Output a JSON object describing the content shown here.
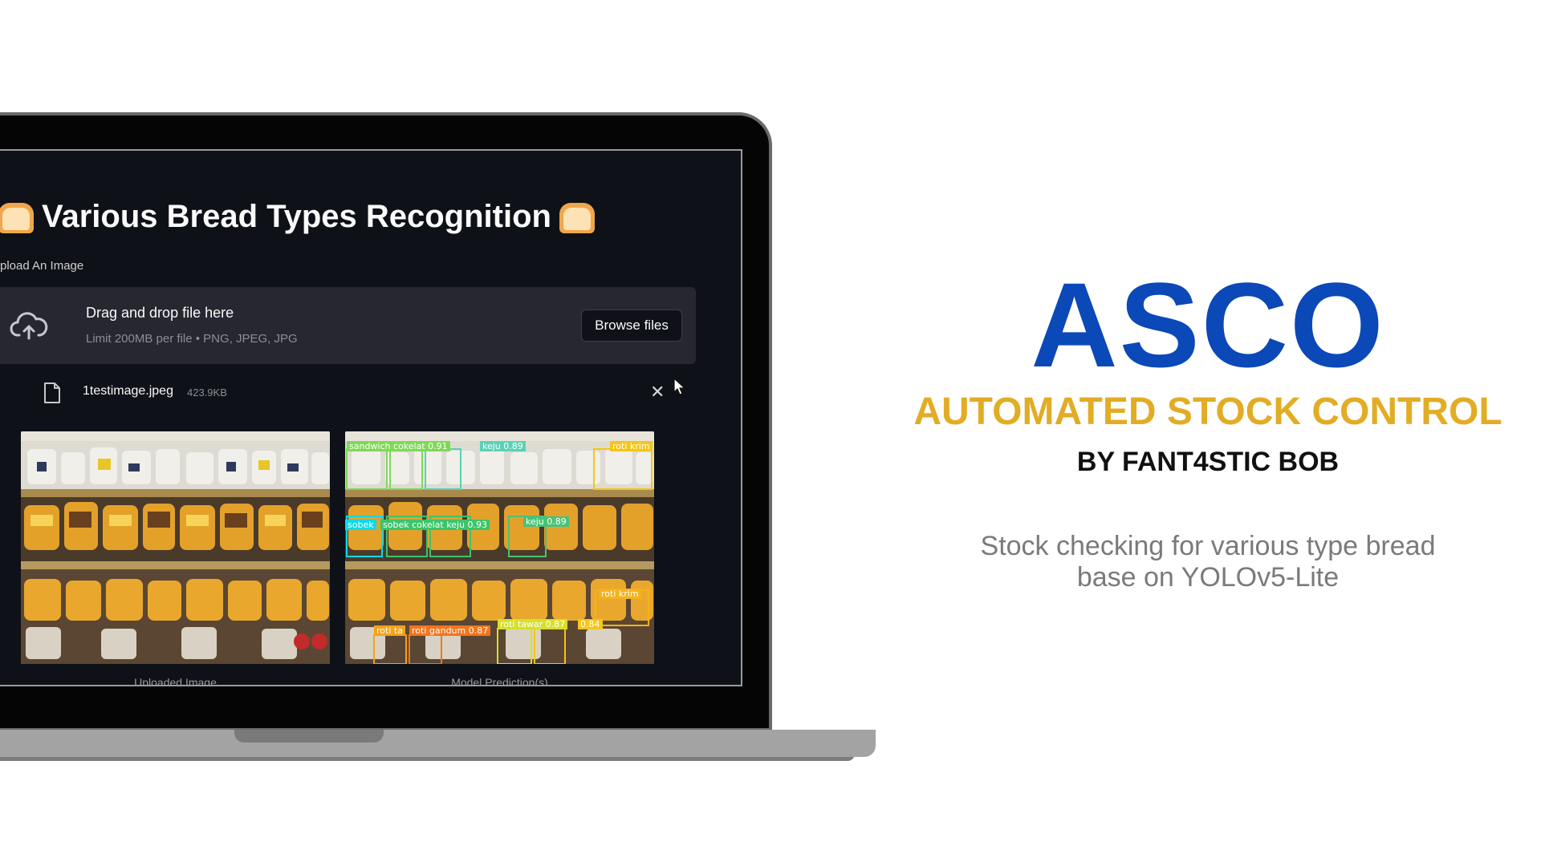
{
  "app": {
    "title": "Various Bread Types Recognition",
    "upload_label": "pload An Image",
    "dropzone": {
      "title": "Drag and drop file here",
      "subtitle": "Limit 200MB per file • PNG, JPEG, JPG",
      "browse_label": "Browse files"
    },
    "file": {
      "name": "1testimage.jpeg",
      "size": "423.9KB"
    },
    "captions": {
      "uploaded": "Uploaded Image",
      "prediction": "Model Prediction(s)"
    },
    "detections": [
      {
        "label": "sandwich cokelat 0.91",
        "color": "#7ed957"
      },
      {
        "label": "keju 0.89",
        "color": "#5ad1b6"
      },
      {
        "label": "roti krim",
        "color": "#f5c518"
      },
      {
        "label": "sobek",
        "color": "#12d8e6"
      },
      {
        "label": "sobek cokelat keju 0.93",
        "color": "#3cc46a"
      },
      {
        "label": "keju 0.89",
        "color": "#49c276"
      },
      {
        "label": "roti krim",
        "color": "#f5b21a"
      },
      {
        "label": "roti ta",
        "color": "#f4a21c"
      },
      {
        "label": "roti gandum 0.87",
        "color": "#f0751e"
      },
      {
        "label": "roti tawar 0.87",
        "color": "#d6e02a"
      },
      {
        "label": "0.84",
        "color": "#f5c518"
      }
    ]
  },
  "brand": {
    "name": "ASCO",
    "tagline": "AUTOMATED STOCK CONTROL",
    "byline": "BY FANT4STIC BOB",
    "description_line1": "Stock checking for various type bread",
    "description_line2": "base on YOLOv5-Lite",
    "colors": {
      "name": "#0b48b8",
      "tagline": "#e2ac25",
      "byline": "#111111",
      "description": "#7a7a7a"
    }
  }
}
